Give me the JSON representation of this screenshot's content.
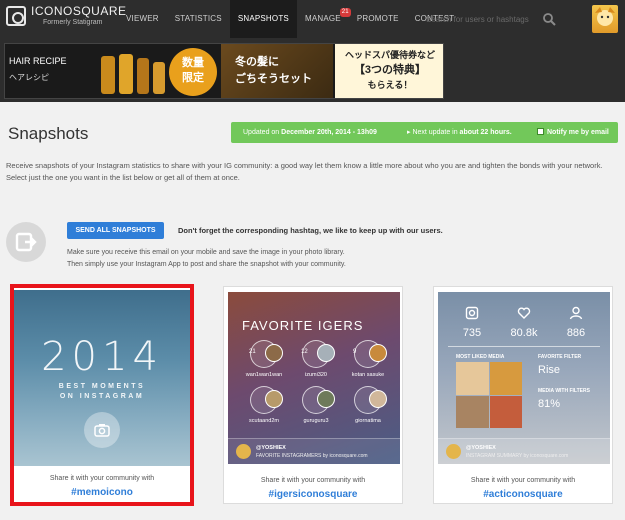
{
  "topbar": {
    "logo_name": "ICONOSQUARE",
    "logo_sub": "Formerly Statigram",
    "nav": [
      {
        "label": "VIEWER"
      },
      {
        "label": "STATISTICS"
      },
      {
        "label": "SNAPSHOTS"
      },
      {
        "label": "MANAGE",
        "badge": "21"
      },
      {
        "label": "PROMOTE"
      },
      {
        "label": "CONTEST"
      }
    ],
    "search_placeholder": "Search for users or hashtags"
  },
  "ad": {
    "brand": "HAIR RECIPE",
    "brand_jp": "ヘアレシピ",
    "limited": "数量\n限定",
    "tagline_1": "冬の髪に",
    "tagline_2": "ごちそうセット",
    "right_1": "ヘッドスパ優待券など",
    "right_2": "【3つの特典】",
    "right_3": "もらえる！"
  },
  "header": {
    "title": "Snapshots",
    "updated_prefix": "Updated on ",
    "updated_date": "December 20th, 2014 - 13h09",
    "next_prefix": "▸ Next update in ",
    "next_value": "about 22 hours.",
    "notify_label": "Notify me by email"
  },
  "intro": "Receive snapshots of your Instagram statistics to share with your IG community: a good way let them know a little more about who you are and tighten the bonds with your network. Select just the one you want in the list below or get all of them at once.",
  "share": {
    "send_all_label": "SEND ALL SNAPSHOTS",
    "note": "Don't forget the corresponding hashtag, we like to keep up with our users.",
    "instr_1": "Make sure you receive this email on your mobile and save the image in your photo library.",
    "instr_2": "Then simply use your Instagram App to post and share the snapshot with your community."
  },
  "cards": [
    {
      "year": "2014",
      "sub_1": "BEST MOMENTS",
      "sub_2": "ON INSTAGRAM",
      "share_text": "Share it with your community with",
      "hashtag": "#memoicono"
    },
    {
      "title": "FAVORITE IGERS",
      "igers": [
        {
          "rank": "21",
          "name": "wan1wan1wan"
        },
        {
          "rank": "12",
          "name": "izumi320"
        },
        {
          "rank": "9",
          "name": "kotan sasuke"
        },
        {
          "rank": "",
          "name": "scutaand2m"
        },
        {
          "rank": "",
          "name": "guruguru3"
        },
        {
          "rank": "",
          "name": "giornatima"
        }
      ],
      "foot_user": "@YOSHIEX",
      "foot_sub": "FAVORITE INSTAGRAMERS by iconosquare.com",
      "share_text": "Share it with your community with",
      "hashtag": "#igersiconosquare"
    },
    {
      "stats": [
        {
          "icon": "square-icon",
          "value": "735"
        },
        {
          "icon": "heart-icon",
          "value": "80.8k"
        },
        {
          "icon": "person-icon",
          "value": "886"
        }
      ],
      "most_liked_label": "MOST LIKED MEDIA",
      "favorite_filter_label": "FAVORITE FILTER",
      "favorite_filter_value": "Rise",
      "media_filters_label": "MEDIA WITH FILTERS",
      "media_filters_value": "81%",
      "foot_user": "@YOSHIEX",
      "foot_sub": "INSTAGRAM SUMMARY by iconosquare.com",
      "share_text": "Share it with your community with",
      "hashtag": "#acticonosquare"
    }
  ],
  "colors": {
    "topbar": "#2d2d2d",
    "update_green": "#72c85a",
    "accent_blue": "#2f7ed8",
    "highlight_red": "#e8141b"
  }
}
